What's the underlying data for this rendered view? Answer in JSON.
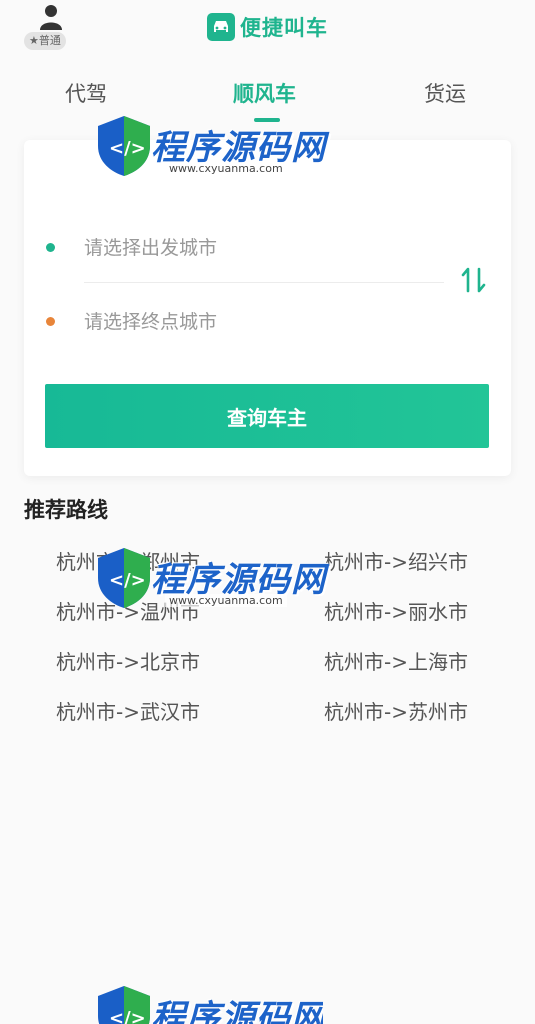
{
  "header": {
    "user_badge": "★普通",
    "brand_title": "便捷叫车",
    "accent": "#1fb48e"
  },
  "tabs": [
    {
      "label": "代驾"
    },
    {
      "label": "顺风车"
    },
    {
      "label": "货运"
    }
  ],
  "search": {
    "start_placeholder": "请选择出发城市",
    "end_placeholder": "请选择终点城市",
    "start_dot_color": "#1fb48e",
    "end_dot_color": "#e8853a",
    "query_label": "查询车主"
  },
  "recommend": {
    "title": "推荐路线",
    "routes": [
      "杭州市->郑州市",
      "杭州市->绍兴市",
      "杭州市->温州市",
      "杭州市->丽水市",
      "杭州市->北京市",
      "杭州市->上海市",
      "杭州市->武汉市",
      "杭州市->苏州市"
    ]
  },
  "watermark": {
    "text": "程序源码网",
    "url": "www.cxyuanma.com"
  }
}
